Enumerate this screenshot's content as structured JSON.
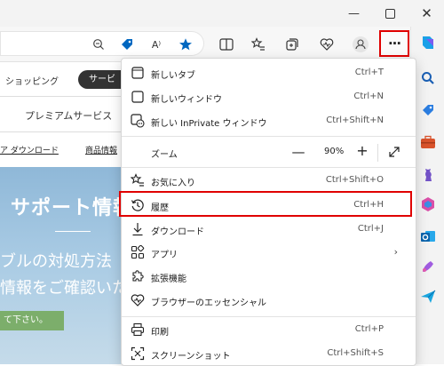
{
  "window": {
    "minimize": "—",
    "close": "✕"
  },
  "toolbar": {
    "read_aloud": "A⁾",
    "more": "···"
  },
  "page": {
    "nav_partial": "ショッピング",
    "nav_pill": "サービ",
    "nav2_partial": "プレミアムサービス",
    "link1": "ア ダウンロード",
    "link2": "商品情報",
    "hero_title": "サポート情報",
    "hero_line1": "ブルの対処方法",
    "hero_line2": "情報をご確認いた",
    "hero_button": "て下さい。"
  },
  "menu": {
    "new_tab": {
      "label": "新しいタブ",
      "shortcut": "Ctrl+T"
    },
    "new_window": {
      "label": "新しいウィンドウ",
      "shortcut": "Ctrl+N"
    },
    "new_inprivate": {
      "label": "新しい InPrivate ウィンドウ",
      "shortcut": "Ctrl+Shift+N"
    },
    "zoom": {
      "label": "ズーム",
      "value": "90%",
      "minus": "—",
      "plus": "+"
    },
    "favorites": {
      "label": "お気に入り",
      "shortcut": "Ctrl+Shift+O"
    },
    "history": {
      "label": "履歴",
      "shortcut": "Ctrl+H"
    },
    "downloads": {
      "label": "ダウンロード",
      "shortcut": "Ctrl+J"
    },
    "apps": {
      "label": "アプリ",
      "arrow": "›"
    },
    "extensions": {
      "label": "拡張機能"
    },
    "essentials": {
      "label": "ブラウザーのエッセンシャル"
    },
    "print": {
      "label": "印刷",
      "shortcut": "Ctrl+P"
    },
    "screenshot": {
      "label": "スクリーンショット",
      "shortcut": "Ctrl+Shift+S"
    }
  },
  "colors": {
    "highlight": "#e00000",
    "accent": "#0067c0"
  }
}
